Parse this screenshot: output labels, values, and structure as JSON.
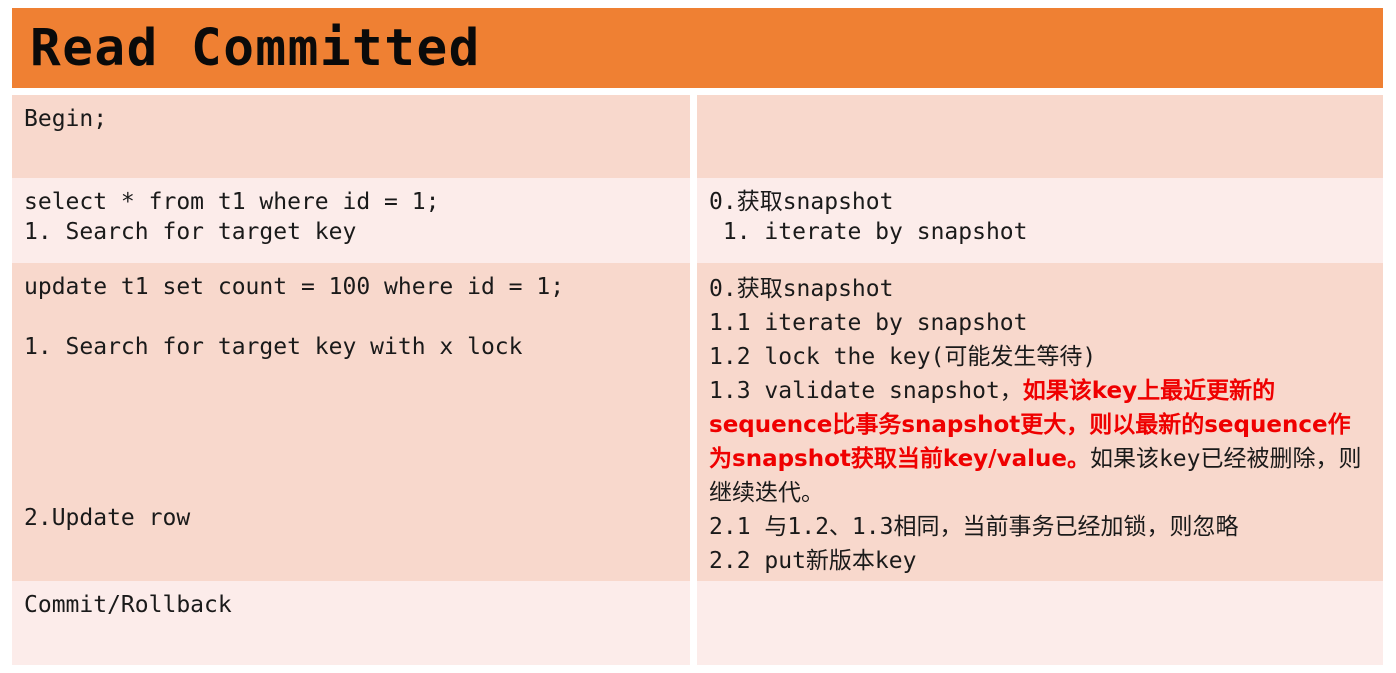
{
  "slide": {
    "title": "Read Committed",
    "accent_color": "#ef8033",
    "highlight_color": "#ef0000",
    "row_shade_dark": "#f8d8cc",
    "row_shade_light": "#fcecea"
  },
  "table": {
    "rows": [
      {
        "id": "row-begin",
        "shade": "dark",
        "left": {
          "lines": [
            "Begin;"
          ]
        },
        "right": {
          "lines": []
        }
      },
      {
        "id": "row-select",
        "shade": "light",
        "left": {
          "lines": [
            "select * from t1 where id = 1;",
            "1. Search for target key"
          ]
        },
        "right": {
          "lines": [
            "0.获取snapshot",
            " 1. iterate by snapshot"
          ]
        }
      },
      {
        "id": "row-update",
        "shade": "dark",
        "left": {
          "statement": "update t1 set count = 100 where id = 1;",
          "step1": "1. Search for target key with x lock",
          "step2": "2.Update row"
        },
        "right": {
          "line0": "0.获取snapshot",
          "line1": "1.1 iterate by snapshot",
          "line2": "1.2 lock the key(可能发生等待)",
          "line3_prefix": "1.3 validate snapshot，",
          "line3_highlight": "如果该key上最近更新的sequence比事务snapshot更大，则以最新的sequence作为snapshot获取当前key/value。",
          "line3_suffix": "如果该key已经被删除，则继续迭代。",
          "line4": "2.1 与1.2、1.3相同，当前事务已经加锁，则忽略",
          "line5": "2.2 put新版本key"
        }
      },
      {
        "id": "row-commit",
        "shade": "light",
        "left": {
          "lines": [
            "Commit/Rollback"
          ]
        },
        "right": {
          "lines": []
        }
      }
    ]
  }
}
